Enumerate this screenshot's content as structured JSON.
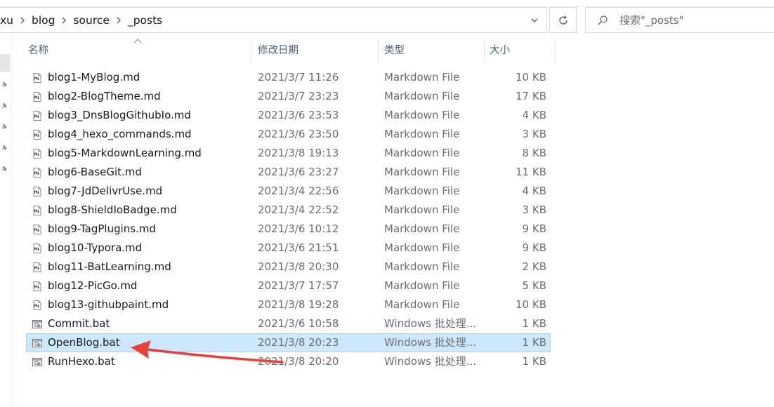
{
  "breadcrumb": {
    "segments": [
      "xu",
      "blog",
      "source",
      "_posts"
    ]
  },
  "search": {
    "placeholder": "搜索\"_posts\""
  },
  "columns": {
    "name": "名称",
    "date": "修改日期",
    "type": "类型",
    "size": "大小"
  },
  "files": [
    {
      "name": "blog1-MyBlog.md",
      "date": "2021/3/7 11:26",
      "type": "Markdown File",
      "size": "10 KB",
      "icon": "markdown-file-icon"
    },
    {
      "name": "blog2-BlogTheme.md",
      "date": "2021/3/7 23:23",
      "type": "Markdown File",
      "size": "17 KB",
      "icon": "markdown-file-icon"
    },
    {
      "name": "blog3_DnsBlogGithubIo.md",
      "date": "2021/3/6 23:53",
      "type": "Markdown File",
      "size": "4 KB",
      "icon": "markdown-file-icon"
    },
    {
      "name": "blog4_hexo_commands.md",
      "date": "2021/3/6 23:50",
      "type": "Markdown File",
      "size": "3 KB",
      "icon": "markdown-file-icon"
    },
    {
      "name": "blog5-MarkdownLearning.md",
      "date": "2021/3/8 19:13",
      "type": "Markdown File",
      "size": "8 KB",
      "icon": "markdown-file-icon"
    },
    {
      "name": "blog6-BaseGit.md",
      "date": "2021/3/6 23:27",
      "type": "Markdown File",
      "size": "11 KB",
      "icon": "markdown-file-icon"
    },
    {
      "name": "blog7-JdDelivrUse.md",
      "date": "2021/3/4 22:56",
      "type": "Markdown File",
      "size": "4 KB",
      "icon": "markdown-file-icon"
    },
    {
      "name": "blog8-ShieldIoBadge.md",
      "date": "2021/3/4 22:52",
      "type": "Markdown File",
      "size": "3 KB",
      "icon": "markdown-file-icon"
    },
    {
      "name": "blog9-TagPlugins.md",
      "date": "2021/3/6 10:12",
      "type": "Markdown File",
      "size": "9 KB",
      "icon": "markdown-file-icon"
    },
    {
      "name": "blog10-Typora.md",
      "date": "2021/3/6 21:51",
      "type": "Markdown File",
      "size": "9 KB",
      "icon": "markdown-file-icon"
    },
    {
      "name": "blog11-BatLearning.md",
      "date": "2021/3/8 20:30",
      "type": "Markdown File",
      "size": "2 KB",
      "icon": "markdown-file-icon"
    },
    {
      "name": "blog12-PicGo.md",
      "date": "2021/3/7 17:57",
      "type": "Markdown File",
      "size": "5 KB",
      "icon": "markdown-file-icon"
    },
    {
      "name": "blog13-githubpaint.md",
      "date": "2021/3/8 19:28",
      "type": "Markdown File",
      "size": "10 KB",
      "icon": "markdown-file-icon"
    },
    {
      "name": "Commit.bat",
      "date": "2021/3/6 10:58",
      "type": "Windows 批处理...",
      "size": "1 KB",
      "icon": "batch-file-icon"
    },
    {
      "name": "OpenBlog.bat",
      "date": "2021/3/8 20:23",
      "type": "Windows 批处理...",
      "size": "1 KB",
      "icon": "batch-file-icon",
      "selected": true
    },
    {
      "name": "RunHexo.bat",
      "date": "2021/3/8 20:20",
      "type": "Windows 批处理...",
      "size": "1 KB",
      "icon": "batch-file-icon"
    }
  ],
  "colors": {
    "selection_bg": "#cce8ff",
    "selection_border": "#99d1ff",
    "header_text": "#4c607a",
    "annotation_arrow": "#e8413c"
  }
}
